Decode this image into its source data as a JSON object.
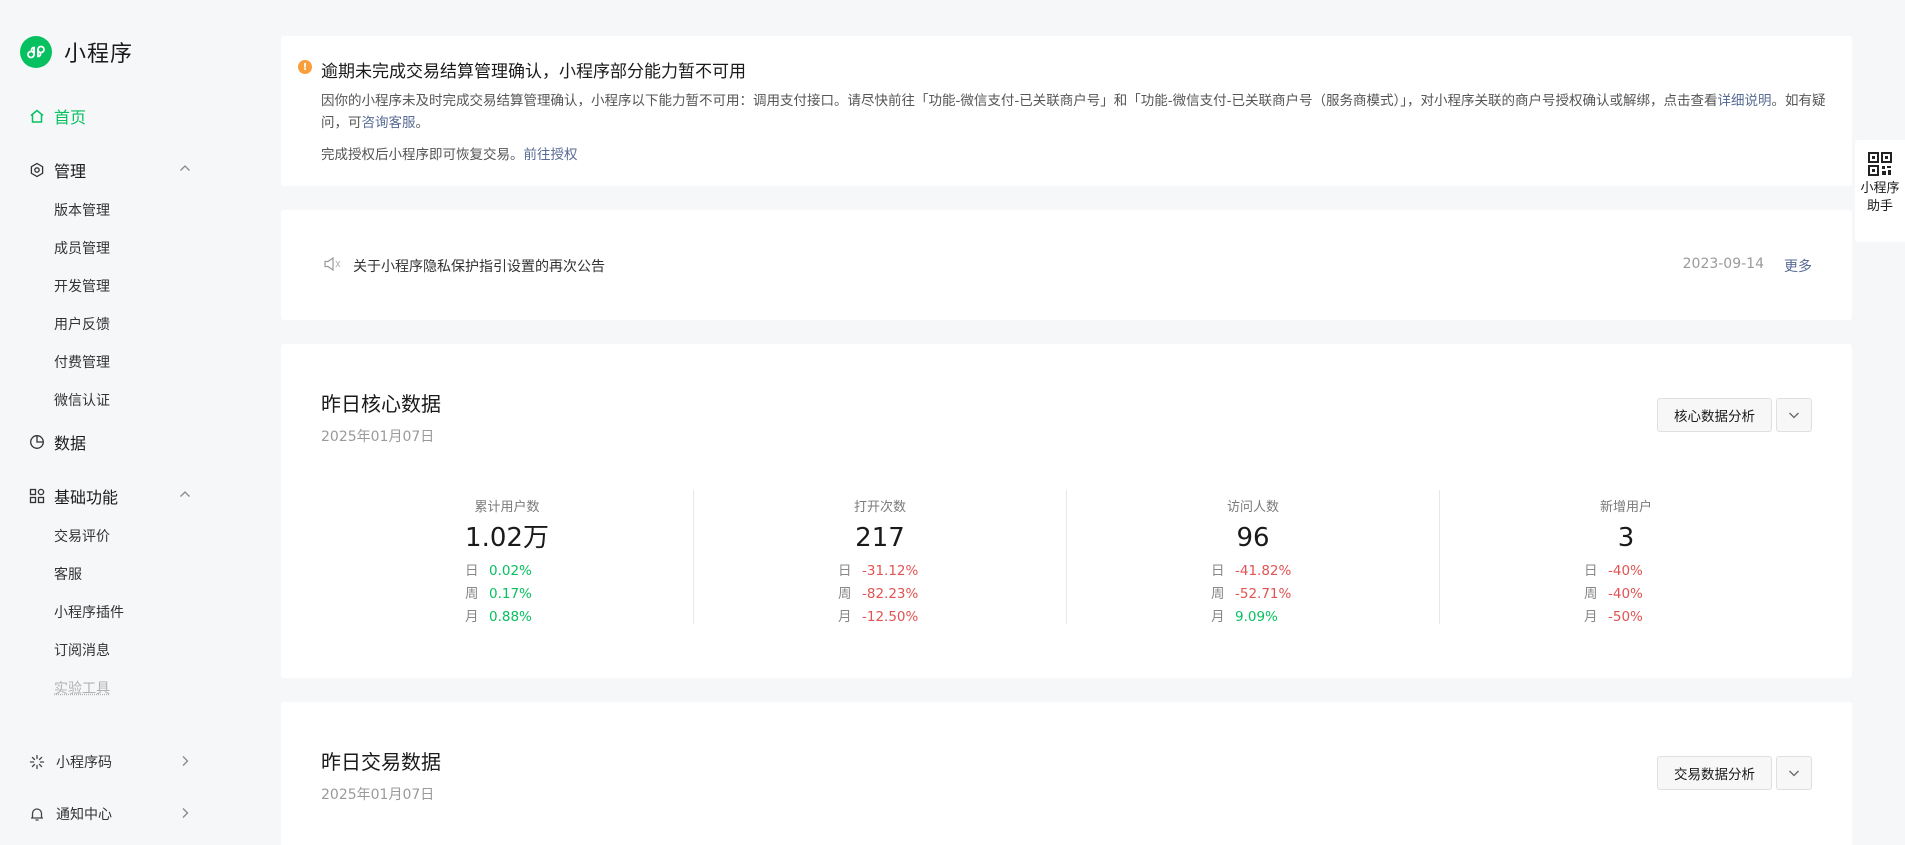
{
  "sidebar": {
    "brand": "小程序",
    "home": "首页",
    "manage": {
      "label": "管理",
      "items": [
        "版本管理",
        "成员管理",
        "开发管理",
        "用户反馈",
        "付费管理",
        "微信认证"
      ]
    },
    "data": "数据",
    "basic": {
      "label": "基础功能",
      "items": [
        "交易评价",
        "客服",
        "小程序插件",
        "订阅消息",
        "实验工具"
      ]
    },
    "qrcode": "小程序码",
    "notify": "通知中心"
  },
  "alert": {
    "title": "逾期未完成交易结算管理确认，小程序部分能力暂不可用",
    "desc": "因你的小程序未及时完成交易结算管理确认，小程序以下能力暂不可用：调用支付接口。请尽快前往「功能-微信支付-已关联商户号」和「功能-微信支付-已关联商户号（服务商模式）」，对小程序关联的商户号授权确认或解绑，点击查看",
    "desc_link": "详细说明",
    "desc_mid": "。如有疑问，可",
    "desc_link2": "咨询客服",
    "desc_end": "。",
    "note": "完成授权后小程序即可恢复交易。",
    "note_link": "前往授权"
  },
  "notice": {
    "text": "关于小程序隐私保护指引设置的再次公告",
    "date": "2023-09-14",
    "more": "更多"
  },
  "core": {
    "title": "昨日核心数据",
    "date": "2025年01月07日",
    "analyze": "核心数据分析",
    "stats": [
      {
        "label": "累计用户数",
        "value": "1.02万",
        "rows": [
          {
            "k": "日",
            "v": "0.02%",
            "c": "#07c160"
          },
          {
            "k": "周",
            "v": "0.17%",
            "c": "#07c160"
          },
          {
            "k": "月",
            "v": "0.88%",
            "c": "#07c160"
          }
        ]
      },
      {
        "label": "打开次数",
        "value": "217",
        "rows": [
          {
            "k": "日",
            "v": "-31.12%",
            "c": "#e25353"
          },
          {
            "k": "周",
            "v": "-82.23%",
            "c": "#e25353"
          },
          {
            "k": "月",
            "v": "-12.50%",
            "c": "#e25353"
          }
        ]
      },
      {
        "label": "访问人数",
        "value": "96",
        "rows": [
          {
            "k": "日",
            "v": "-41.82%",
            "c": "#e25353"
          },
          {
            "k": "周",
            "v": "-52.71%",
            "c": "#e25353"
          },
          {
            "k": "月",
            "v": "9.09%",
            "c": "#07c160"
          }
        ]
      },
      {
        "label": "新增用户",
        "value": "3",
        "rows": [
          {
            "k": "日",
            "v": "-40%",
            "c": "#e25353"
          },
          {
            "k": "周",
            "v": "-40%",
            "c": "#e25353"
          },
          {
            "k": "月",
            "v": "-50%",
            "c": "#e25353"
          }
        ]
      }
    ]
  },
  "trade": {
    "title": "昨日交易数据",
    "date": "2025年01月07日",
    "analyze": "交易数据分析"
  },
  "assistant": {
    "line1": "小程序",
    "line2": "助手"
  },
  "colors": {
    "brand": "#07c160",
    "link": "#576b95",
    "negative": "#e25353",
    "warning": "#fa9d3b"
  }
}
